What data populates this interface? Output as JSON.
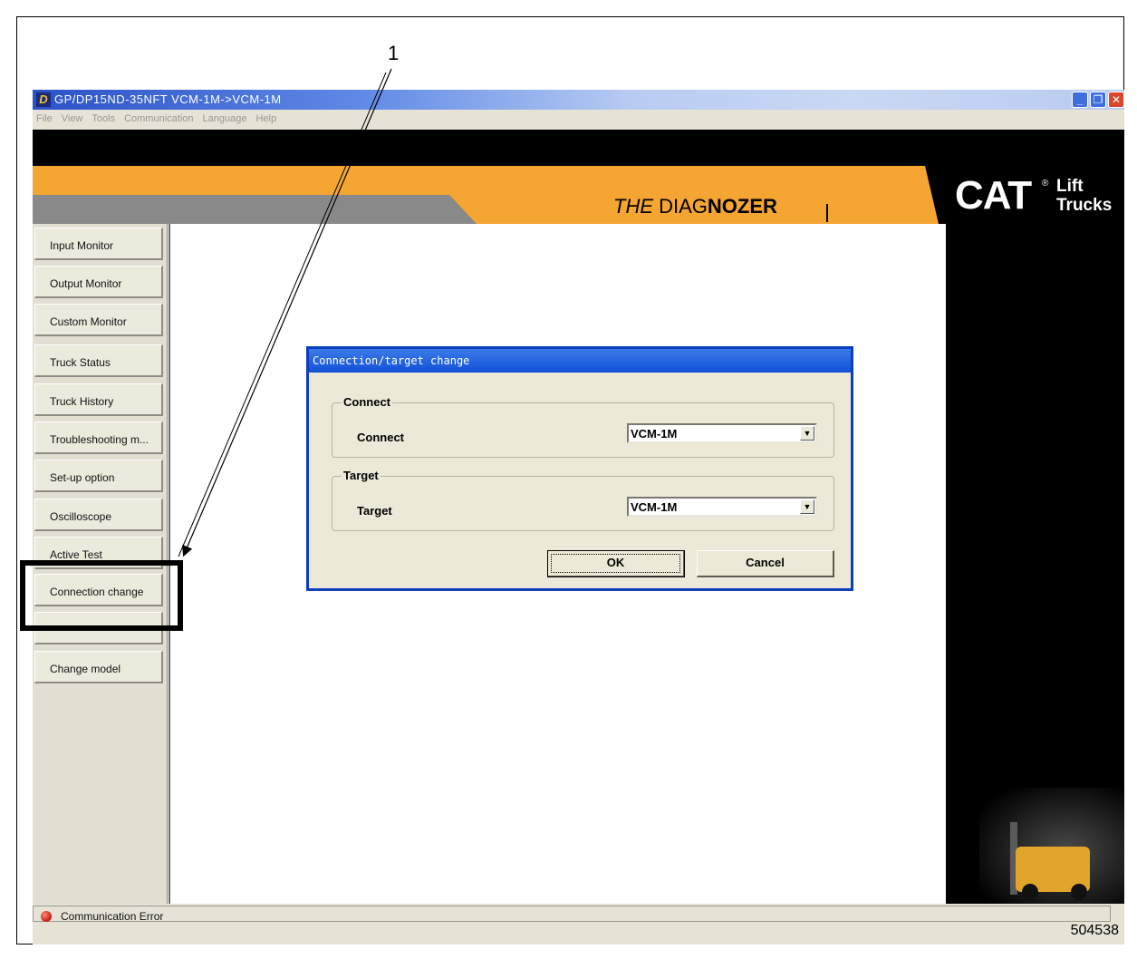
{
  "callout": {
    "number": "1"
  },
  "doc_number": "504538",
  "window": {
    "title": "GP/DP15ND-35NFT VCM-1M->VCM-1M",
    "menu": [
      "File",
      "View",
      "Tools",
      "Communication",
      "Language",
      "Help"
    ]
  },
  "banner": {
    "brand_prefix": "THE ",
    "brand_mid": "DIAG",
    "brand_bold": "NOZER",
    "logo": "CAT",
    "logo_reg": "®",
    "logo_line1": "Lift",
    "logo_line2": "Trucks"
  },
  "sidebar": {
    "items": [
      {
        "label": "Input Monitor"
      },
      {
        "label": "Output Monitor"
      },
      {
        "label": "Custom Monitor"
      },
      {
        "label": "Truck Status"
      },
      {
        "label": "Truck History"
      },
      {
        "label": "Troubleshooting m..."
      },
      {
        "label": "Set-up option"
      },
      {
        "label": "Oscilloscope"
      },
      {
        "label": "Active Test"
      },
      {
        "label": "Connection change"
      },
      {
        "label": ""
      },
      {
        "label": "Change model"
      }
    ]
  },
  "dialog": {
    "title": "Connection/target change",
    "connect_group": "Connect",
    "connect_label": "Connect",
    "connect_value": "VCM-1M",
    "target_group": "Target",
    "target_label": "Target",
    "target_value": "VCM-1M",
    "ok_label": "OK",
    "cancel_label": "Cancel"
  },
  "status": {
    "text": "Communication Error"
  },
  "colors": {
    "banner_orange": "#f5a531",
    "title_blue": "#2b52c8",
    "dialog_border": "#0b3fbd"
  }
}
